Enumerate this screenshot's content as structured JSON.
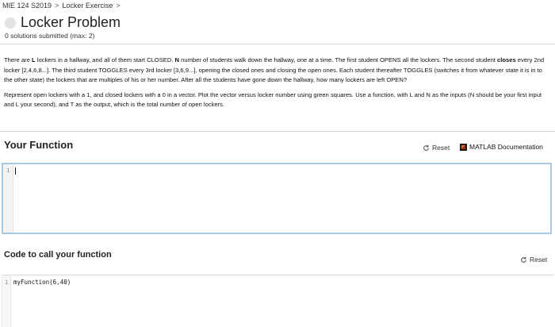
{
  "breadcrumb": {
    "course": "MIE 124 S2019",
    "sep1": ">",
    "page": "Locker Exercise",
    "sep2": ">"
  },
  "header": {
    "title": "Locker Problem",
    "solutions": "0 solutions submitted (max: 2)"
  },
  "description": {
    "p1_a": "There are ",
    "p1_b_bold": "L",
    "p1_c": " lockers in a hallway, and all of them start CLOSED. ",
    "p1_d_bold": "N",
    "p1_e": " number of students walk down the hallway, one at a time. The first student OPENS all the lockers. The second student ",
    "p1_f_bold": "closes",
    "p1_g": " every 2nd locker [2,4,6,8...]. The third student TOGGLES every 3rd locker [3,6,9...], opening the closed ones and closing the open ones. Each student thereafter TOGGLES (switches it from whatever state it is in to the other state) the lockers that are multiples of his or her number. After all the students have gone down the hallway, how many lockers are left OPEN?",
    "p2": "Represent open lockers with a 1, and closed lockers with a 0 in a vector. Plot the vector versus locker number using green squares. Use a function, with L and N as the inputs (N should be your first input and L your second), and T as the output, which is the total number of open lockers."
  },
  "your_function": {
    "heading": "Your Function",
    "reset_label": "Reset",
    "doc_label": "MATLAB Documentation",
    "line_number": "1",
    "code": ""
  },
  "call_function": {
    "heading": "Code to call your function",
    "reset_label": "Reset",
    "line_number": "1",
    "code": "myFunction(6,40)"
  }
}
